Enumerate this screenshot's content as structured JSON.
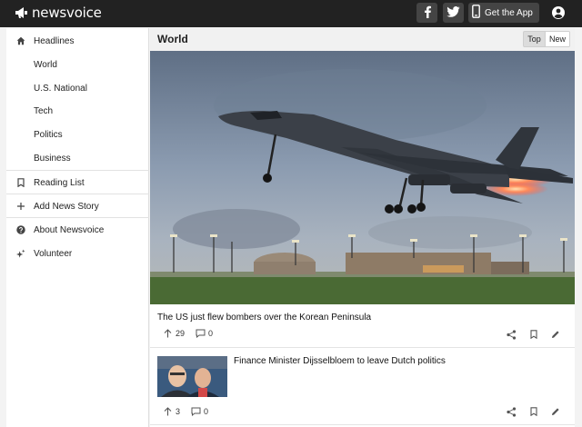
{
  "header": {
    "logo_text": "newsvoice",
    "get_app_label": "Get the App",
    "icons": [
      "megaphone-icon",
      "facebook-icon",
      "twitter-icon",
      "phone-icon",
      "account-icon"
    ]
  },
  "sidebar": {
    "items": [
      {
        "label": "Headlines",
        "icon": "home-icon"
      },
      {
        "label": "World"
      },
      {
        "label": "U.S. National"
      },
      {
        "label": "Tech"
      },
      {
        "label": "Politics"
      },
      {
        "label": "Business"
      },
      {
        "label": "Reading List",
        "icon": "bookmark-icon"
      },
      {
        "label": "Add News Story",
        "icon": "plus-icon"
      },
      {
        "label": "About Newsvoice",
        "icon": "help-icon"
      },
      {
        "label": "Volunteer",
        "icon": "sparkle-icon"
      }
    ]
  },
  "main": {
    "section_title": "World",
    "sort_options": [
      "Top",
      "New"
    ],
    "selected_sort": "Top",
    "stories": [
      {
        "title": "The US just flew bombers over the Korean Peninsula",
        "votes": "29",
        "comments": "0"
      },
      {
        "title": "Finance Minister Dijsselbloem to leave Dutch politics",
        "votes": "3",
        "comments": "0"
      }
    ]
  },
  "colors": {
    "topbar": "#222222",
    "header_button": "#444444",
    "sidebar_bg": "#ffffff",
    "page_bg": "#f3f3f3"
  }
}
